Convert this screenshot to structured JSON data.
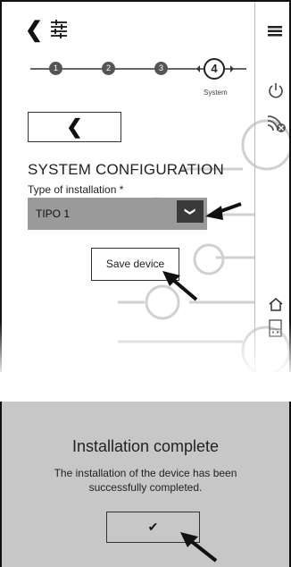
{
  "header": {
    "back_icon": "chevron-left-icon",
    "settings_icon": "sliders-icon"
  },
  "stepper": {
    "steps": [
      "1",
      "2",
      "3",
      "4"
    ],
    "active_step": 4,
    "active_caption": "System"
  },
  "rail": {
    "menu_icon": "hamburger-menu-icon",
    "power_icon": "power-icon",
    "signal_icon": "wireless-off-icon",
    "home_icon": "home-icon",
    "device_icon": "panel-device-icon"
  },
  "form": {
    "back_glyph": "❮",
    "section_title": "SYSTEM CONFIGURATION",
    "field_label": "Type of installation *",
    "select_value": "TIPO 1",
    "select_arrow": "❯",
    "save_label": "Save device"
  },
  "completion": {
    "title": "Installation complete",
    "message": "The installation of the device has been successfully completed.",
    "confirm_glyph": "✔"
  },
  "colors": {
    "select_bg": "#9a9a9a",
    "select_arrow_bg": "#3a3a3a",
    "panel_bg": "#c7c7c7",
    "step_fill": "#555555"
  }
}
